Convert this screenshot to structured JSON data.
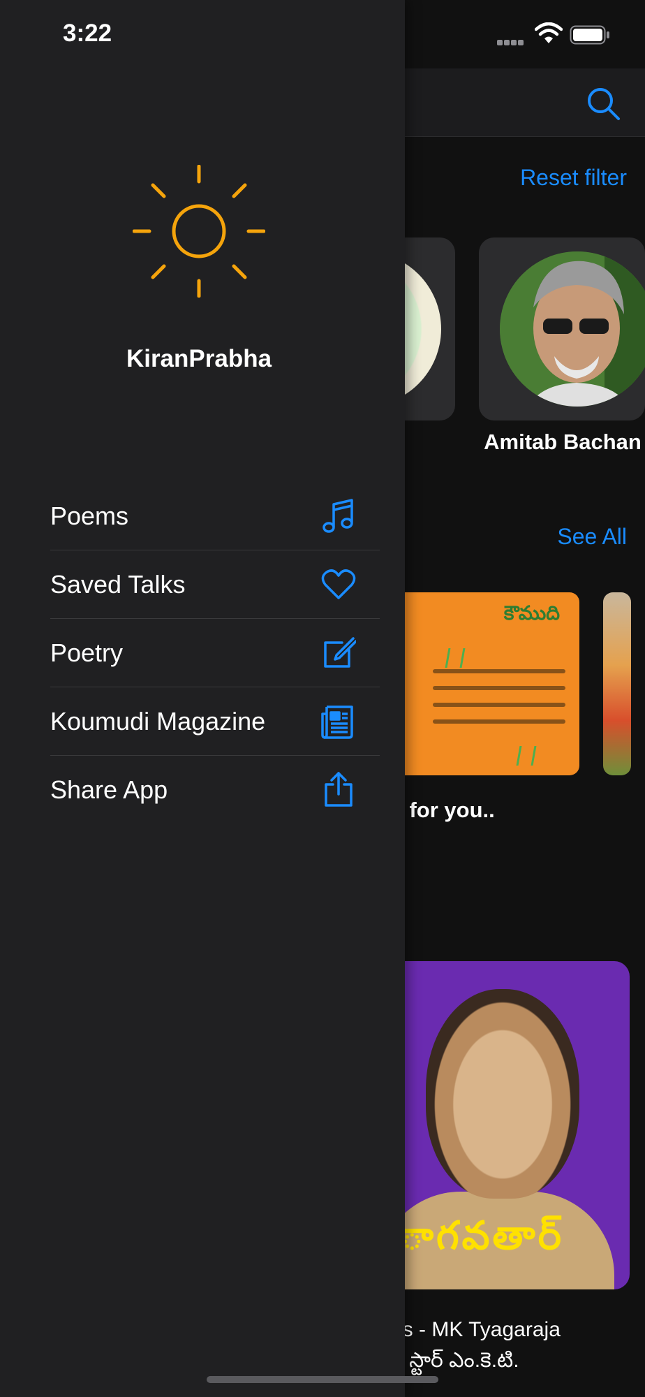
{
  "status_bar": {
    "time": "3:22"
  },
  "drawer": {
    "app_name": "KiranPrabha",
    "logo_icon": "sun-icon",
    "accent_color": "#f5a40c",
    "icon_color": "#1a8cff",
    "menu": [
      {
        "label": "Poems",
        "icon": "music-note-icon"
      },
      {
        "label": "Saved Talks",
        "icon": "heart-icon"
      },
      {
        "label": "Poetry",
        "icon": "compose-icon"
      },
      {
        "label": "Koumudi Magazine",
        "icon": "newspaper-icon"
      },
      {
        "label": "Share App",
        "icon": "share-icon"
      }
    ]
  },
  "main": {
    "reset_filter": "Reset filter",
    "artist_name": "Amitab Bachan",
    "see_all": "See All",
    "magazine_title": "కౌముది",
    "section_title": "ng for you..",
    "poster_banner": "ాగవతార్",
    "poster_title_line1": "es - MK Tyagaraja",
    "poster_title_line2": "ర్ స్టార్ ఎం.కె.టి."
  }
}
